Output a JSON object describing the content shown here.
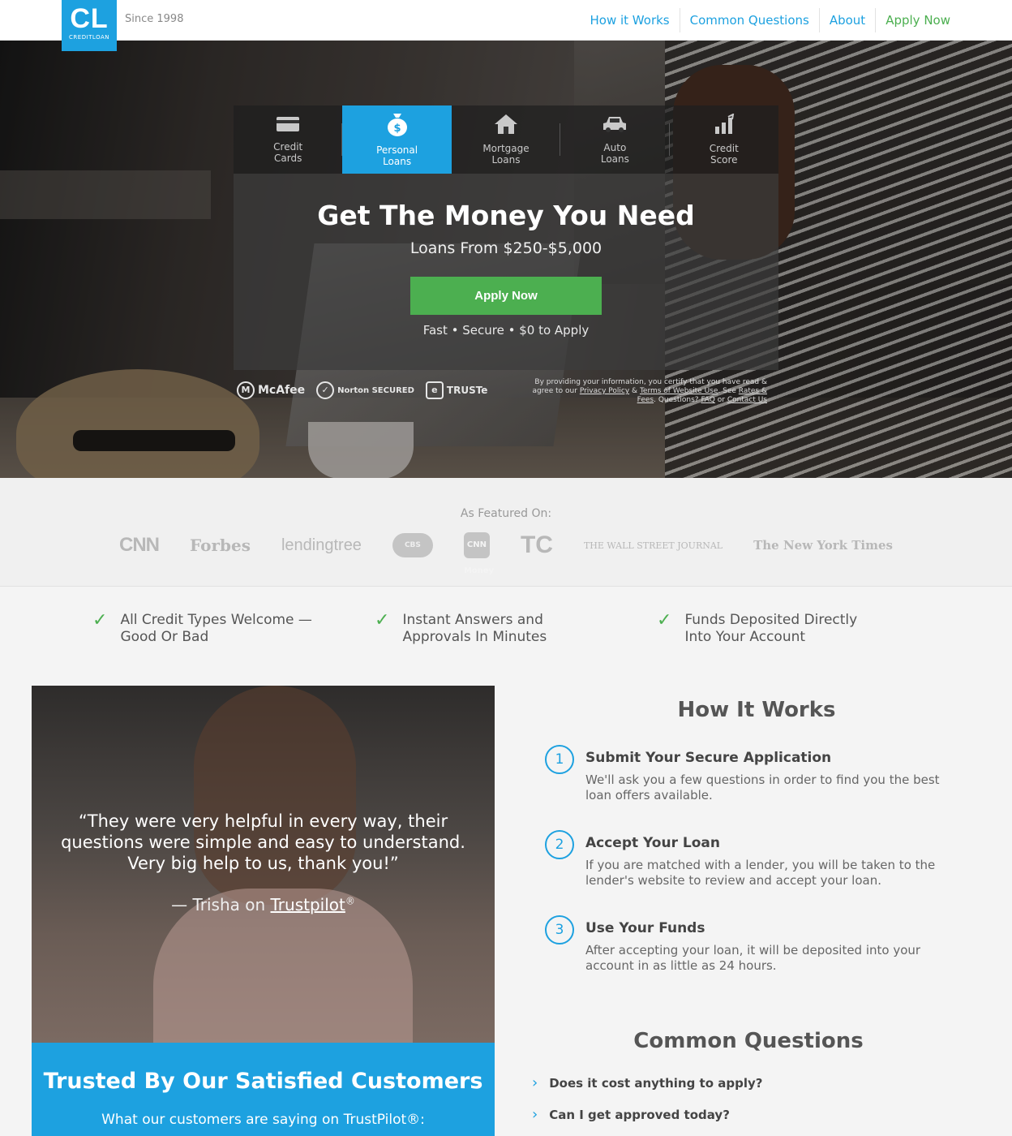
{
  "header": {
    "logo_text": "CL",
    "logo_sub": "CREDITLOAN",
    "since": "Since 1998",
    "nav": {
      "how": "How it Works",
      "questions": "Common Questions",
      "about": "About",
      "apply": "Apply Now"
    }
  },
  "hero": {
    "tabs": [
      {
        "line1": "Credit",
        "line2": "Cards",
        "icon": "credit-card-icon"
      },
      {
        "line1": "Personal",
        "line2": "Loans",
        "icon": "money-bag-icon"
      },
      {
        "line1": "Mortgage",
        "line2": "Loans",
        "icon": "house-icon"
      },
      {
        "line1": "Auto",
        "line2": "Loans",
        "icon": "car-icon"
      },
      {
        "line1": "Credit",
        "line2": "Score",
        "icon": "bar-chart-icon"
      }
    ],
    "title": "Get The Money You Need",
    "subtitle": "Loans From $250-$5,000",
    "apply_button": "Apply Now",
    "tagline": "Fast • Secure • $0 to Apply",
    "badges": {
      "mcafee": "McAfee",
      "norton": "Norton SECURED",
      "truste": "TRUSTe"
    },
    "disclaimer": {
      "part1": "By providing your information, you certify that you have read & agree to our",
      "privacy": "Privacy Policy",
      "and": "&",
      "terms": "Terms of Website Use",
      "see": ". See",
      "rates": "Rates & Fees",
      "questions": ". Questions?",
      "faq": "FAQ",
      "or": "or",
      "contact": "Contact Us"
    }
  },
  "featured": {
    "label": "As Featured On:",
    "logos": {
      "cnn": "CNN",
      "forbes": "Forbes",
      "lendingtree": "lendingtree",
      "cbs": "CBS",
      "cnnmoney": "CNN Money",
      "tc": "TC",
      "wsj": "THE WALL STREET JOURNAL",
      "nyt": "The New York Times"
    }
  },
  "benefits": [
    "All Credit Types Welcome — Good Or Bad",
    "Instant Answers and Approvals In Minutes",
    "Funds Deposited Directly Into Your Account"
  ],
  "testimonial": {
    "quote": "“They were very helpful in every way, their questions were simple and easy to understand. Very big help to us, thank you!”",
    "by_prefix": "— Trisha on",
    "by_link": "Trustpilot",
    "reg": "®"
  },
  "trusted": {
    "title": "Trusted By Our Satisfied Customers",
    "subtitle": "What our customers are saying on TrustPilot®:"
  },
  "how_it_works": {
    "title": "How It Works",
    "steps": [
      {
        "num": "1",
        "title": "Submit Your Secure Application",
        "desc": "We'll ask you a few questions in order to find you the best loan offers available."
      },
      {
        "num": "2",
        "title": "Accept Your Loan",
        "desc": "If you are matched with a lender, you will be taken to the lender's website to review and accept your loan."
      },
      {
        "num": "3",
        "title": "Use Your Funds",
        "desc": "After accepting your loan, it will be deposited into your account in as little as 24 hours."
      }
    ]
  },
  "common_questions": {
    "title": "Common Questions",
    "items": [
      "Does it cost anything to apply?",
      "Can I get approved today?"
    ]
  },
  "colors": {
    "brand_blue": "#1da1e0",
    "accent_green": "#4caf50"
  }
}
